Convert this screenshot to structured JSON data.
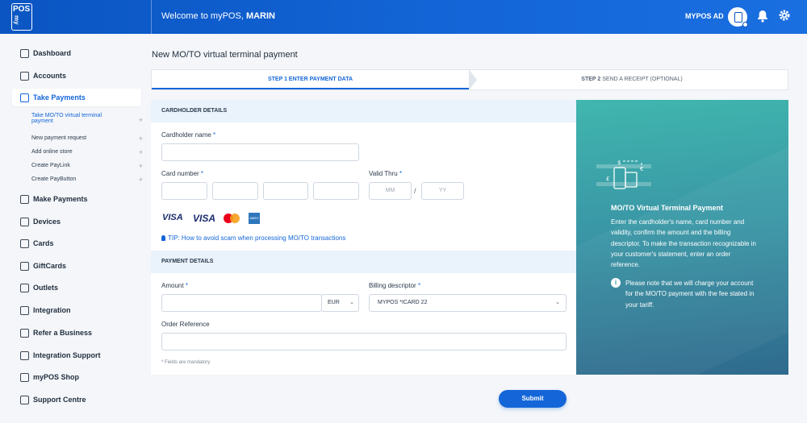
{
  "header": {
    "logo_text": "POS",
    "logo_sub": "my",
    "welcome_prefix": "Welcome to myPOS, ",
    "welcome_name": "MARIN",
    "account_name": "MYPOS AD"
  },
  "sidebar": {
    "items": [
      {
        "label": "Dashboard",
        "icon": "dashboard-icon"
      },
      {
        "label": "Accounts",
        "icon": "wallet-icon"
      },
      {
        "label": "Take Payments",
        "icon": "card-icon"
      },
      {
        "label": "Make Payments",
        "icon": "send-icon"
      },
      {
        "label": "Devices",
        "icon": "device-icon"
      },
      {
        "label": "Cards",
        "icon": "cards-icon"
      },
      {
        "label": "GiftCards",
        "icon": "gift-icon"
      },
      {
        "label": "Outlets",
        "icon": "tag-icon"
      },
      {
        "label": "Integration",
        "icon": "integration-icon"
      },
      {
        "label": "Refer a Business",
        "icon": "megaphone-icon"
      },
      {
        "label": "Integration Support",
        "icon": "cart-icon"
      },
      {
        "label": "myPOS Shop",
        "icon": "shop-icon"
      },
      {
        "label": "Support Centre",
        "icon": "support-icon"
      }
    ],
    "subitems": [
      {
        "label": "Take MO/TO virtual terminal",
        "label2": "payment"
      },
      {
        "label": "New payment request"
      },
      {
        "label": "Add online store"
      },
      {
        "label": "Create PayLink"
      },
      {
        "label": "Create PayButton"
      }
    ]
  },
  "main": {
    "title": "New MO/TO virtual terminal payment",
    "step1": "STEP 1 ENTER PAYMENT DATA",
    "step2_bold": "STEP 2",
    "step2_rest": " SEND A RECEIPT (OPTIONAL)",
    "cardholder_section": "CARDHOLDER DETAILS",
    "cardholder_name_label": "Cardholder name",
    "card_number_label": "Card number",
    "valid_thru_label": "Valid Thru",
    "mm_placeholder": "MM",
    "yy_placeholder": "YY",
    "separator": "/",
    "visa1": "VISA",
    "visa2": "VISA",
    "tip": "TIP: How to avoid scam when processing MO/TO transactions",
    "payment_section": "PAYMENT DETAILS",
    "amount_label": "Amount",
    "currency": "EUR",
    "billing_label": "Billing descriptor",
    "billing_value": "MYPOS  *ICARD 22",
    "order_ref_label": "Order Reference",
    "mandatory_note": "* Fields are mandatory",
    "required_mark": "*",
    "submit": "Submit"
  },
  "info": {
    "title": "MO/TO Virtual Terminal Payment",
    "text": "Enter the cardholder's name, card number and validity, confirm the amount and the billing descriptor. To make the transaction recognizable in your customer's statement, enter an order reference.",
    "note": "Please note that we will charge your account for the MO/TO payment with the fee stated in your tariff."
  },
  "colors": {
    "brand": "#1466d8",
    "panel": "#3a97a6"
  }
}
